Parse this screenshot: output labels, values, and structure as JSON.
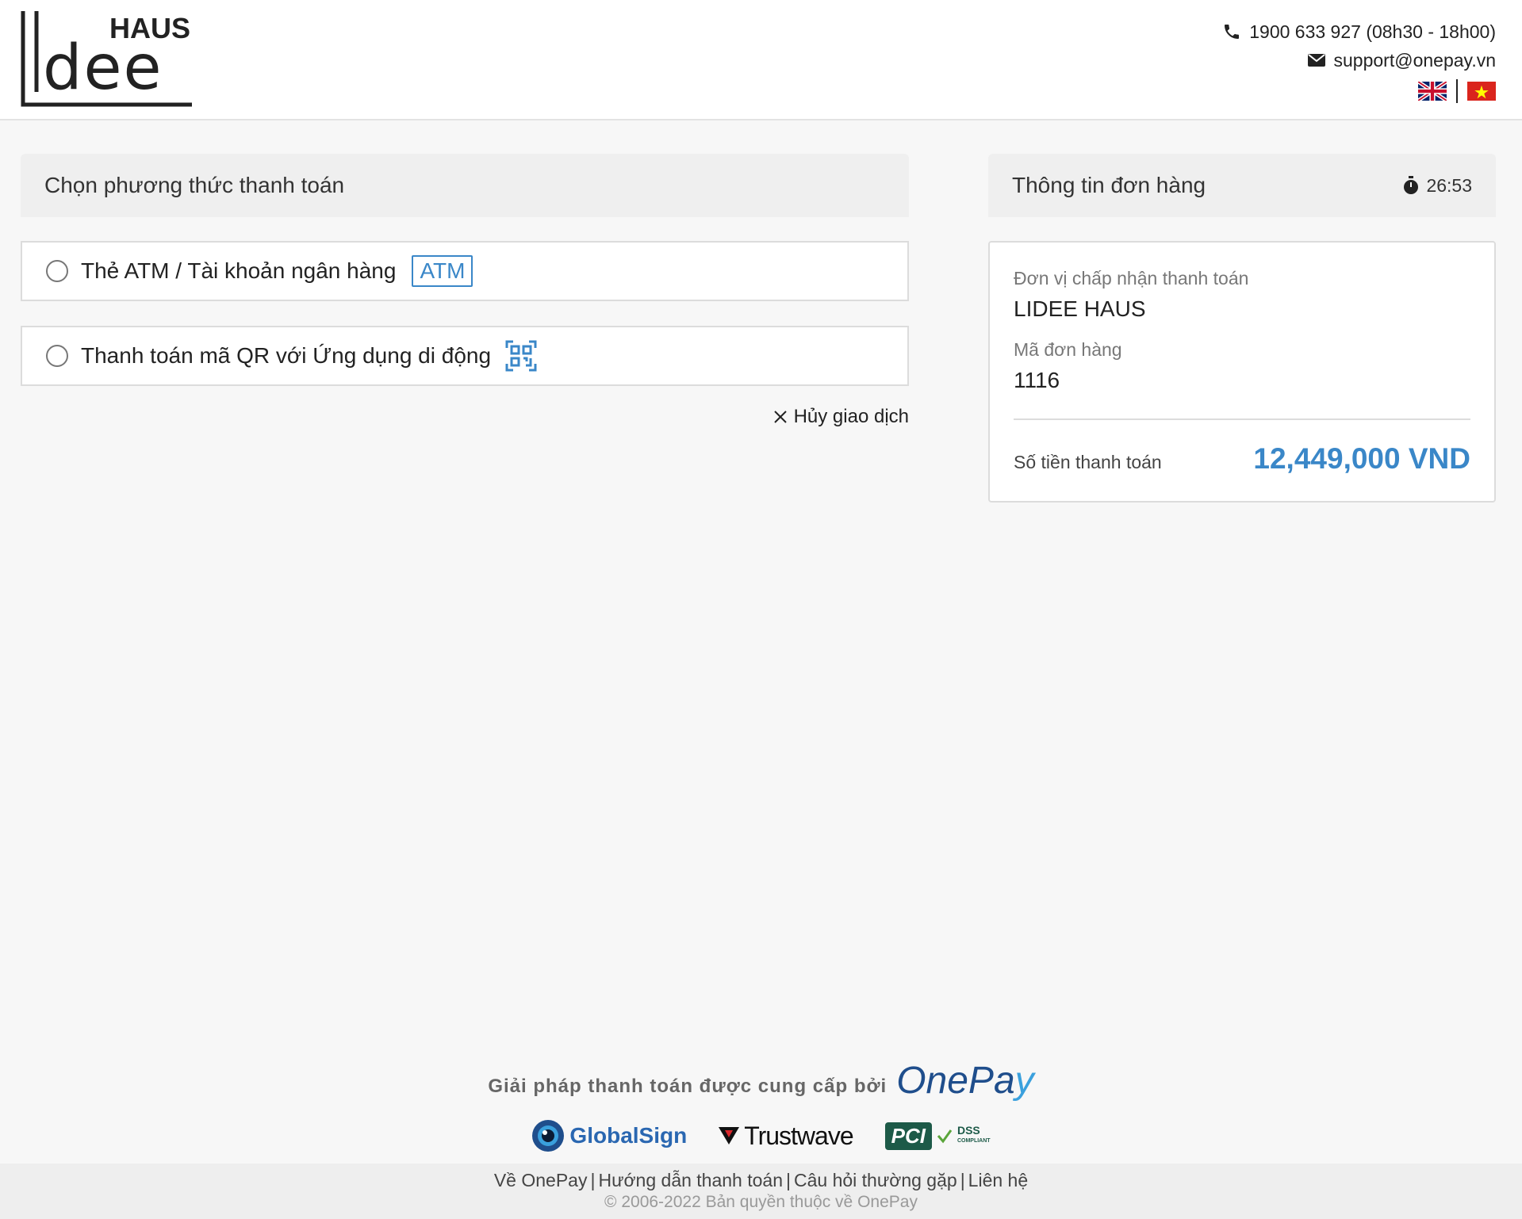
{
  "header": {
    "logo_text_top": "HAUS",
    "logo_text_main": "Lidee",
    "phone": "1900 633 927 (08h30 - 18h00)",
    "email": "support@onepay.vn",
    "languages": [
      "english-flag",
      "vietnamese-flag"
    ]
  },
  "payment": {
    "heading": "Chọn phương thức thanh toán",
    "options": [
      {
        "label": "Thẻ ATM / Tài khoản ngân hàng",
        "badge": "ATM"
      },
      {
        "label": "Thanh toán mã QR với Ứng dụng di động",
        "icon": "qr-code-icon"
      }
    ],
    "cancel_label": "Hủy giao dịch"
  },
  "order": {
    "heading": "Thông tin đơn hàng",
    "timer": "26:53",
    "merchant_label": "Đơn vị chấp nhận thanh toán",
    "merchant_value": "LIDEE HAUS",
    "order_id_label": "Mã đơn hàng",
    "order_id_value": "1116",
    "amount_label": "Số tiền thanh toán",
    "amount_value": "12,449,000 VND"
  },
  "footer": {
    "powered_by": "Giải pháp thanh toán được cung cấp bởi",
    "brand_one": "OnePa",
    "brand_y": "y",
    "certs": {
      "globalsign": "GlobalSign",
      "trustwave": "Trustwave",
      "pci": "PCI",
      "dss": "DSS",
      "compliant": "COMPLIANT"
    },
    "links": [
      "Về OnePay",
      "Hướng dẫn thanh toán",
      "Câu hỏi thường gặp",
      "Liên hệ"
    ],
    "copyright": "© 2006-2022 Bản quyền thuộc về OnePay"
  },
  "colors": {
    "accent": "#3a87c8",
    "onepay_dark": "#1f4e8c",
    "onepay_light": "#3aa0dd",
    "panel_bg": "#efefef"
  }
}
